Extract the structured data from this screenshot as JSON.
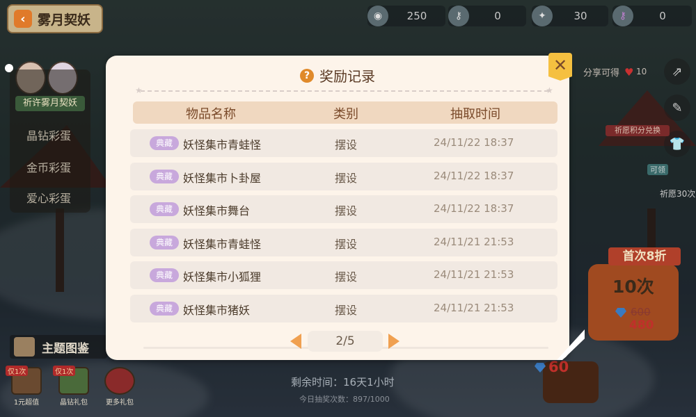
{
  "header": {
    "back_label": "雾月契妖",
    "resources": [
      {
        "icon": "eye-icon",
        "value": "250"
      },
      {
        "icon": "key-icon",
        "value": "0"
      },
      {
        "icon": "sparkle-icon",
        "value": "30"
      },
      {
        "icon": "key-purple-icon",
        "value": "0"
      }
    ]
  },
  "left_menu": {
    "banner": "祈许雾月契妖",
    "items": [
      "晶钻彩蛋",
      "金币彩蛋",
      "爱心彩蛋"
    ]
  },
  "right_panel": {
    "share_text": "分享可得",
    "share_count": "10",
    "wish_exchange": "祈愿积分兑换",
    "can_receive": "可领",
    "wish_30": "祈愿30次",
    "first_discount": "首次8折",
    "ten_draw": "10次",
    "price_old": "600",
    "price_new": "480",
    "single_price": "60"
  },
  "bottom": {
    "topic_album": "主题图鉴",
    "gifts": [
      {
        "tag": "仅1次",
        "label": "1元超值"
      },
      {
        "tag": "仅1次",
        "label": "晶钻礼包"
      },
      {
        "tag": "",
        "label": "更多礼包"
      }
    ],
    "remaining_time": "剩余时间：16天1小时",
    "today_draws": "今日抽奖次数：897/1000"
  },
  "modal": {
    "title": "奖励记录",
    "columns": [
      "物品名称",
      "类别",
      "抽取时间"
    ],
    "rows": [
      {
        "badge": "典藏",
        "name": "妖怪集市青蛙怪",
        "category": "摆设",
        "time": "24/11/22 18:37"
      },
      {
        "badge": "典藏",
        "name": "妖怪集市卜卦屋",
        "category": "摆设",
        "time": "24/11/22 18:37"
      },
      {
        "badge": "典藏",
        "name": "妖怪集市舞台",
        "category": "摆设",
        "time": "24/11/22 18:37"
      },
      {
        "badge": "典藏",
        "name": "妖怪集市青蛙怪",
        "category": "摆设",
        "time": "24/11/21 21:53"
      },
      {
        "badge": "典藏",
        "name": "妖怪集市小狐狸",
        "category": "摆设",
        "time": "24/11/21 21:53"
      },
      {
        "badge": "典藏",
        "name": "妖怪集市猪妖",
        "category": "摆设",
        "time": "24/11/21 21:53"
      }
    ],
    "page_indicator": "2/5"
  },
  "colors": {
    "modal_bg": "#fdf4ea",
    "header_row": "#f0d8c0",
    "row_bg": "#f1e9e2",
    "badge": "#c8a8dc",
    "accent_orange": "#f0a050",
    "close_yellow": "#f5c040"
  }
}
